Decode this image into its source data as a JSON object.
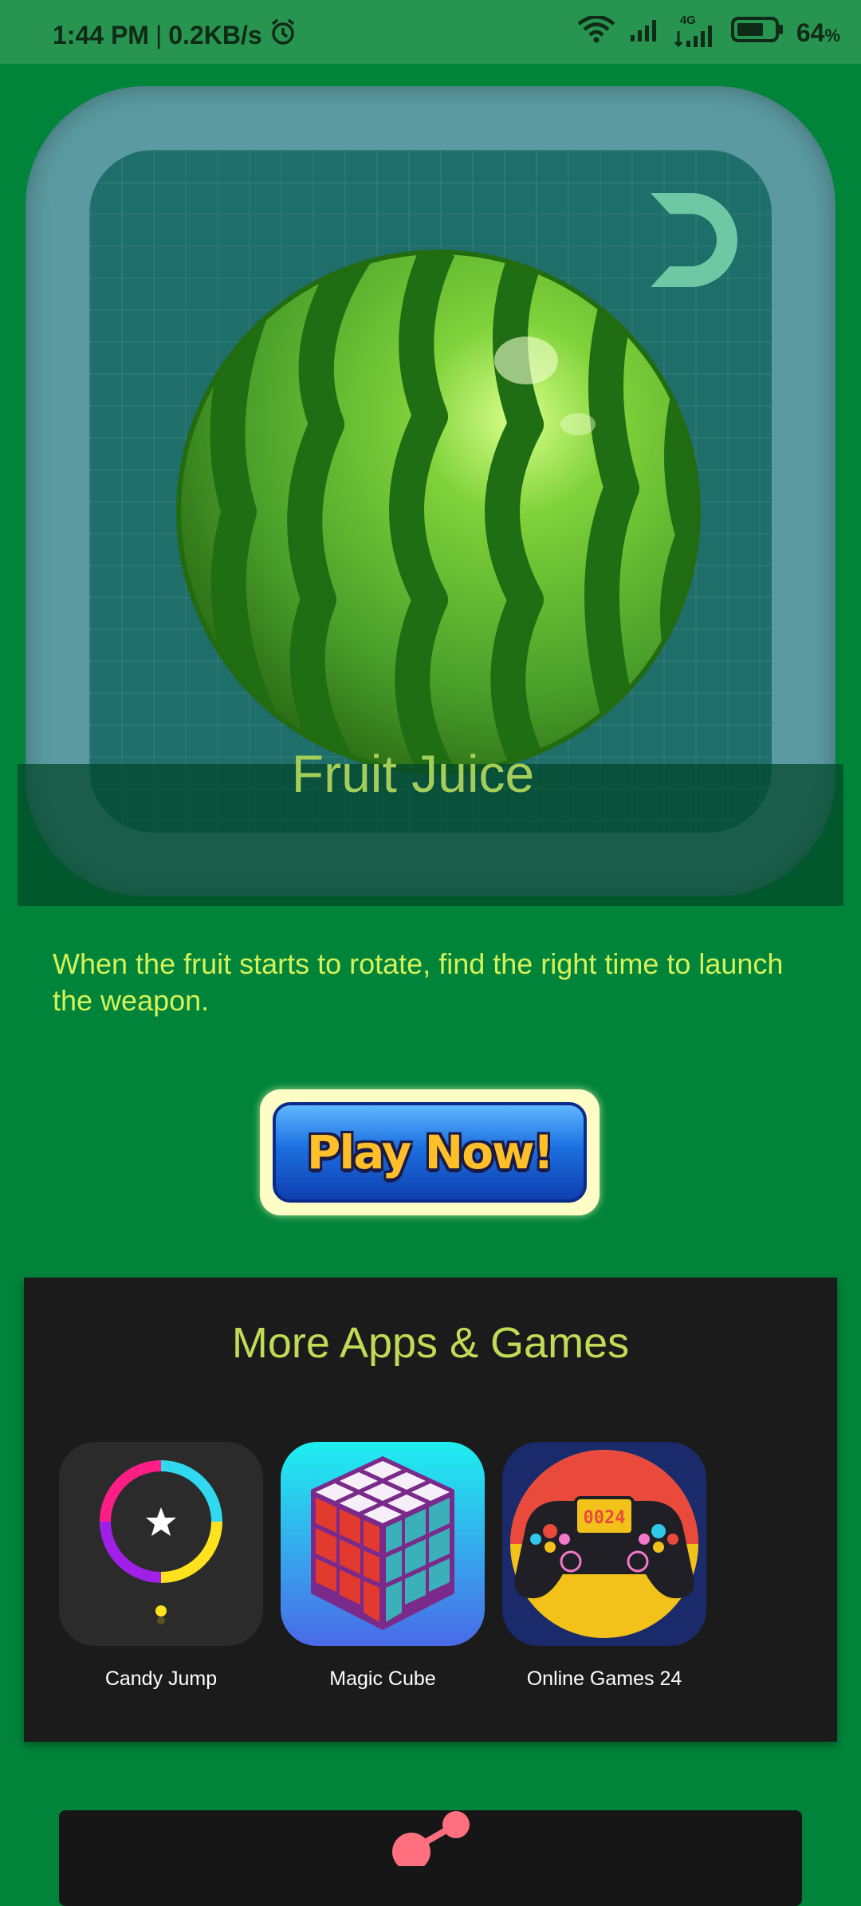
{
  "status_bar": {
    "time": "1:44 PM",
    "separator": "|",
    "speed": "0.2KB/s",
    "network": "4G",
    "battery": "64",
    "battery_unit": "%",
    "icons": [
      "alarm-icon",
      "wifi-icon",
      "signal-icon",
      "signal-4g-icon",
      "battery-icon"
    ]
  },
  "game": {
    "title": "Fruit Juice",
    "description": "When the fruit starts to rotate, find the right time to launch the weapon.",
    "play_label": "Play Now!"
  },
  "more": {
    "title": "More Apps & Games",
    "apps": [
      {
        "label": "Candy Jump",
        "icon": "candy-jump-icon"
      },
      {
        "label": "Magic Cube",
        "icon": "magic-cube-icon"
      },
      {
        "label": "Online Games 24",
        "icon": "online-games-icon",
        "badge": "0024"
      }
    ]
  },
  "colors": {
    "background": "#00843a",
    "title": "#a4cd5a",
    "description": "#d6f25a",
    "panel": "#1b1b1b",
    "panel_title": "#c2da55"
  }
}
